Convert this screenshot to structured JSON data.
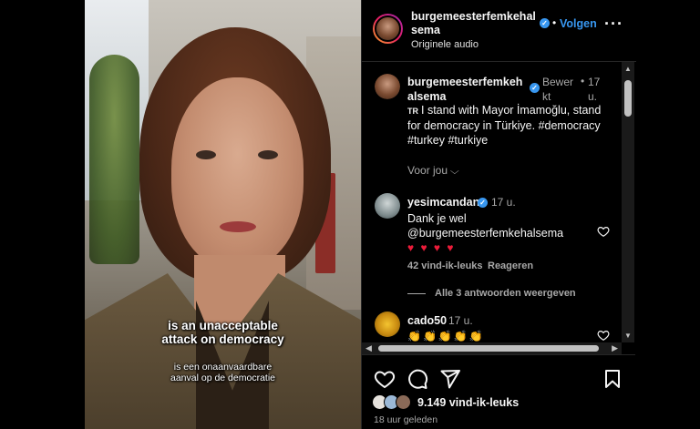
{
  "video": {
    "subtitle_main_line1": "is an unacceptable",
    "subtitle_main_line2": "attack on democracy",
    "subtitle_translation_line1": "is een onaanvaardbare",
    "subtitle_translation_line2": "aanval op de democratie"
  },
  "header": {
    "username": "burgemeesterfemkehalsema",
    "audio": "Originele audio",
    "dot": "•",
    "follow_label": "Volgen",
    "more_icon": "more-horizontal-icon",
    "more_label": "···"
  },
  "caption": {
    "username": "burgemeesterfemkehalsema",
    "edited": "Bewerkt",
    "dot": "•",
    "time": "17 u.",
    "translation_badge": "TR",
    "text": "I stand with Mayor İmamoğlu, stand for democracy in Türkiye. #democracy #turkey #turkiye",
    "for_you": "Voor jou",
    "chevron": "⌵"
  },
  "comments": [
    {
      "username": "yesimcandan",
      "time": "17 u.",
      "text": "Dank je wel @burgemeesterfemkehalsema",
      "emoji": "♥ ♥ ♥ ♥",
      "likes": "42 vind-ik-leuks",
      "reply": "Reageren",
      "view_replies": "Alle 3 antwoorden weergeven"
    },
    {
      "username": "cado50",
      "time": "17 u.",
      "emoji": "👏👏👏👏👏"
    }
  ],
  "scrollbar": {
    "up": "▲",
    "down": "▼",
    "left": "◀",
    "right": "▶"
  },
  "actions": {
    "like_icon": "heart-icon",
    "comment_icon": "comment-icon",
    "share_icon": "send-icon",
    "save_icon": "bookmark-icon",
    "likes_count": "9.149 vind-ik-leuks",
    "posted": "18 uur geleden"
  },
  "colors": {
    "accent": "#3897f0",
    "background": "#000000",
    "muted_text": "#a8a8a8",
    "heart_red": "#ed1c3a"
  }
}
